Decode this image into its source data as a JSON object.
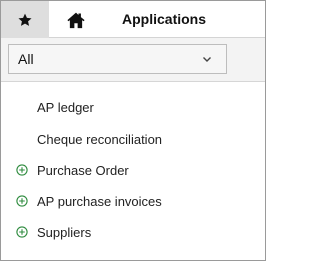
{
  "tabs": {
    "favorites_icon": "star-icon",
    "home_icon": "home-icon",
    "applications_label": "Applications"
  },
  "filter": {
    "selected": "All",
    "icon": "chevron-down-icon"
  },
  "list": {
    "items": [
      {
        "label": "AP ledger",
        "expandable": false
      },
      {
        "label": "Cheque reconciliation",
        "expandable": false
      },
      {
        "label": "Purchase Order",
        "expandable": true
      },
      {
        "label": "AP purchase invoices",
        "expandable": true
      },
      {
        "label": "Suppliers",
        "expandable": true
      }
    ]
  },
  "colors": {
    "expand_icon": "#2e8b3e",
    "fav_tab_bg": "#dedede",
    "filter_bg": "#f3f3f3"
  }
}
